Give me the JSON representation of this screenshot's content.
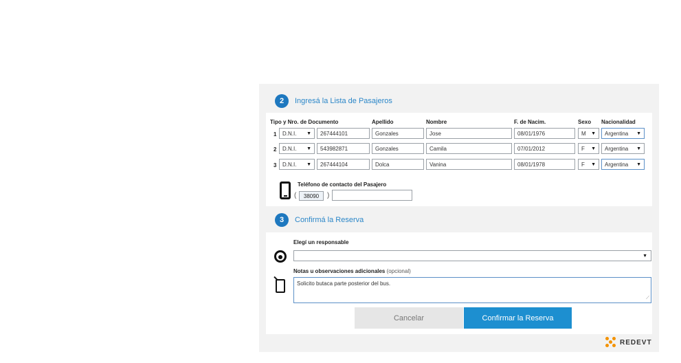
{
  "passengers_section": {
    "step": "2",
    "title": "Ingresá la Lista de Pasajeros",
    "columns": {
      "doc": "Tipo y Nro. de Documento",
      "surname": "Apellido",
      "name": "Nombre",
      "birth": "F. de Nacim.",
      "sex": "Sexo",
      "nationality": "Nacionalidad"
    },
    "rows": [
      {
        "num": "1",
        "doc_type": "D.N.I.",
        "doc_number": "267444101",
        "surname": "Gonzales",
        "name": "Jose",
        "birth": "08/01/1976",
        "sex": "M",
        "nationality": "Argentina"
      },
      {
        "num": "2",
        "doc_type": "D.N.I.",
        "doc_number": "543982871",
        "surname": "Gonzales",
        "name": "Camila",
        "birth": "07/01/2012",
        "sex": "F",
        "nationality": "Argentina"
      },
      {
        "num": "3",
        "doc_type": "D.N.I.",
        "doc_number": "267444104",
        "surname": "Dolca",
        "name": "Vanina",
        "birth": "08/01/1978",
        "sex": "F",
        "nationality": "Argentina"
      }
    ],
    "phone": {
      "label": "Teléfono de contacto del Pasajero",
      "open_paren": "(",
      "close_paren": ")",
      "area_code": "38090",
      "number": ""
    }
  },
  "confirm_section": {
    "step": "3",
    "title": "Confirmá la Reserva",
    "responsible_label": "Elegí un responsable",
    "responsible_value": "",
    "notes_label": "Notas u observaciones adicionales",
    "notes_optional": "(opcional)",
    "notes_value": "Solicito butaca parte posterior del bus.",
    "cancel_label": "Cancelar",
    "confirm_label": "Confirmar la Reserva"
  },
  "icons": {
    "dropdown": "▼",
    "resize": "⟋"
  },
  "brand": {
    "name": "REDEVT",
    "color": "#f39200"
  },
  "colors": {
    "accent": "#1e78bf",
    "confirm_button": "#1d8fd0",
    "panel_bg": "#f2f2f2"
  }
}
